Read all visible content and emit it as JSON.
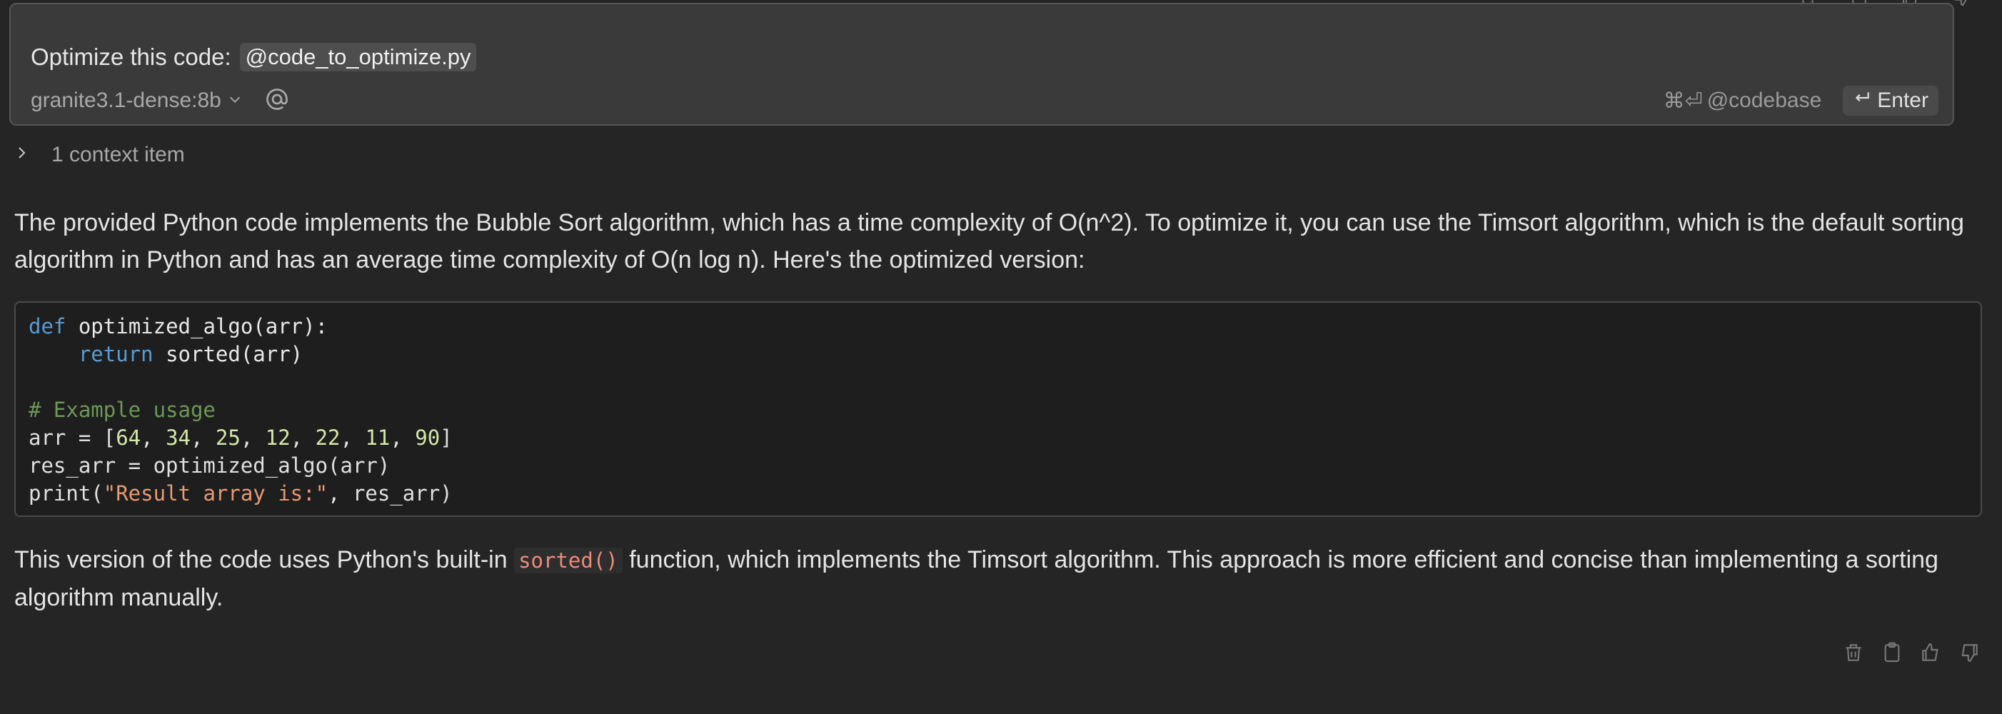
{
  "input": {
    "prompt_text": "Optimize this code:",
    "mention": "@code_to_optimize.py",
    "model": "granite3.1-dense:8b",
    "codebase_shortcut": "⌘⏎",
    "codebase_label": "@codebase",
    "enter_label": "Enter"
  },
  "context": {
    "label": "1 context item"
  },
  "response": {
    "paragraph1": "The provided Python code implements the Bubble Sort algorithm, which has a time complexity of O(n^2). To optimize it, you can use the Timsort algorithm, which is the default sorting algorithm in Python and has an average time complexity of O(n log n). Here's the optimized version:",
    "paragraph2_before": "This version of the code uses Python's built-in ",
    "inline_code": "sorted()",
    "paragraph2_after": " function, which implements the Timsort algorithm. This approach is more efficient and concise than implementing a sorting algorithm manually."
  },
  "code": {
    "line1_kw": "def",
    "line1_rest": " optimized_algo(arr):",
    "line2_indent": "    ",
    "line2_kw": "return",
    "line2_rest": " sorted(arr)",
    "line4_comment": "# Example usage",
    "line5_start": "arr = [",
    "nums": [
      "64",
      "34",
      "25",
      "12",
      "22",
      "11",
      "90"
    ],
    "line5_end": "]",
    "line6": "res_arr = optimized_algo(arr)",
    "line7_start": "print(",
    "line7_string": "\"Result array is:\"",
    "line7_end": ", res_arr)"
  },
  "icons": {
    "actions": [
      "trash-icon",
      "clipboard-icon",
      "thumbs-up-icon",
      "thumbs-down-icon"
    ]
  }
}
